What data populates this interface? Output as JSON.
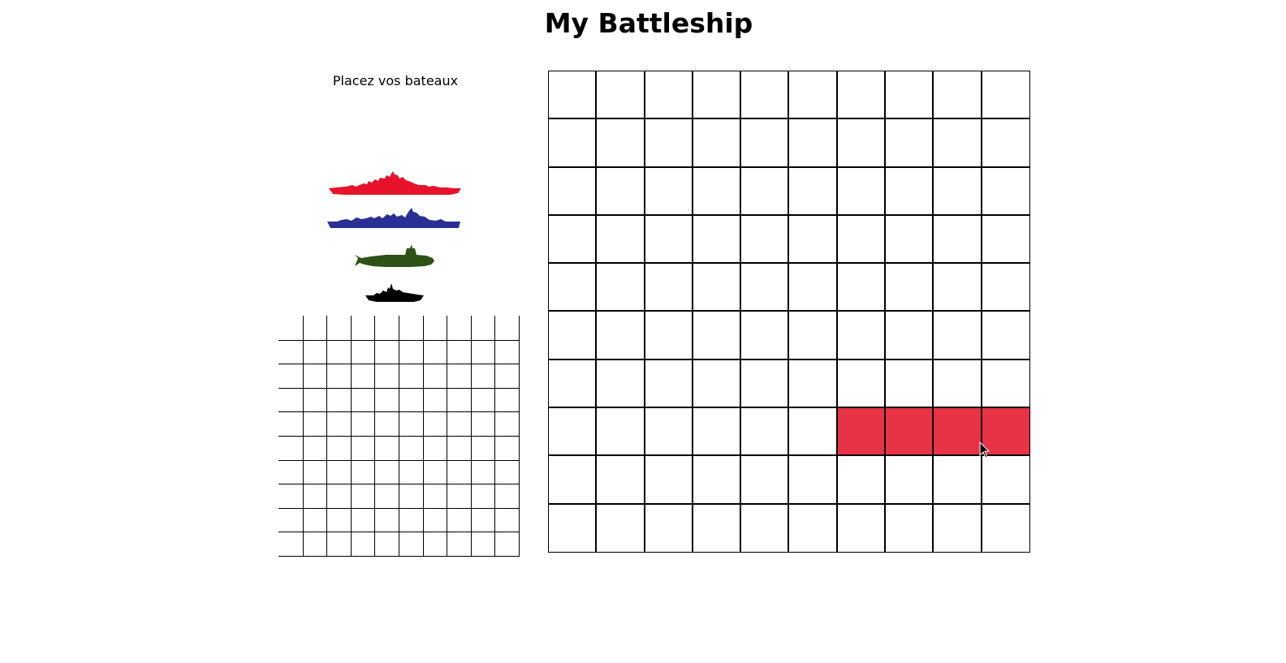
{
  "title": "My Battleship",
  "instructions": "Placez vos bateaux",
  "colors": {
    "highlight": "#e83246",
    "cell": "#ffffff",
    "grid_line": "#000000"
  },
  "ships": [
    {
      "name": "battleship",
      "icon": "battleship-icon",
      "color": "#e8132a"
    },
    {
      "name": "cruiser",
      "icon": "cruiser-icon",
      "color": "#2a2f95"
    },
    {
      "name": "submarine",
      "icon": "submarine-icon",
      "color": "#2e5116"
    },
    {
      "name": "patrol-boat",
      "icon": "patrol-boat-icon",
      "color": "#000000"
    }
  ],
  "small_grid": {
    "rows": 10,
    "cols": 10
  },
  "target_grid": {
    "rows": 10,
    "cols": 10,
    "highlighted_cells": [
      [
        7,
        6
      ],
      [
        7,
        7
      ],
      [
        7,
        8
      ],
      [
        7,
        9
      ]
    ]
  }
}
